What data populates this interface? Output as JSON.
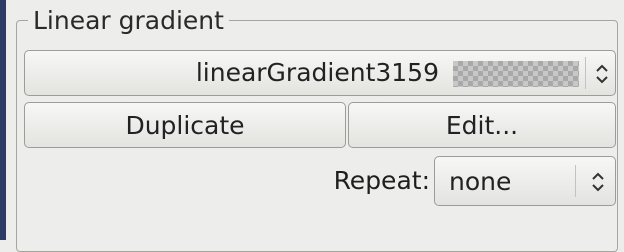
{
  "section": {
    "title": "Linear gradient"
  },
  "gradient_select": {
    "value": "linearGradient3159",
    "icon": "updown-arrows-icon"
  },
  "buttons": {
    "duplicate": "Duplicate",
    "edit": "Edit..."
  },
  "repeat": {
    "label": "Repeat:",
    "value": "none",
    "icon": "updown-arrows-icon"
  }
}
